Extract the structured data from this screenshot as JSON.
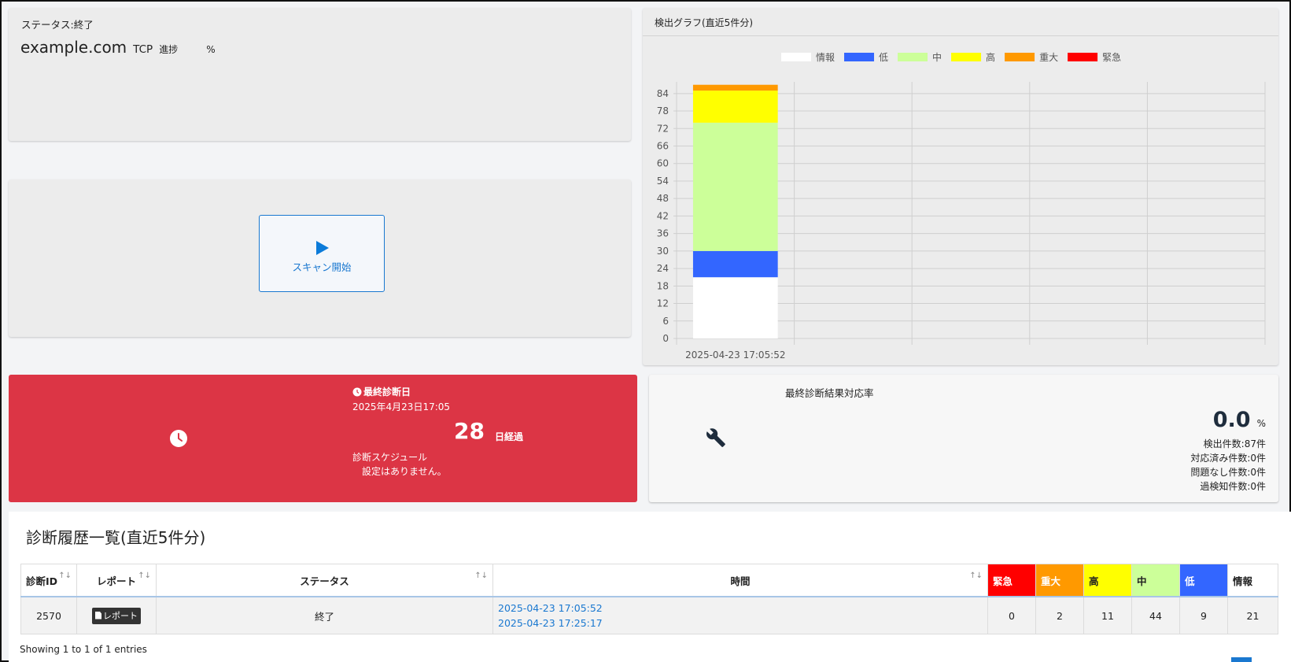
{
  "status": {
    "label": "ステータス:終了",
    "host": "example.com",
    "protocol": "TCP",
    "progress_label": "進捗",
    "progress_unit": "%"
  },
  "scan": {
    "button_label": "スキャン開始",
    "icon": "play-icon"
  },
  "chart_panel": {
    "title": "検出グラフ(直近5件分)"
  },
  "chart_data": {
    "type": "bar",
    "stacked": true,
    "categories": [
      "2025-04-23 17:05:52"
    ],
    "series": [
      {
        "name": "情報",
        "values": [
          21
        ],
        "color": "#ffffff"
      },
      {
        "name": "低",
        "values": [
          9
        ],
        "color": "#3366ff"
      },
      {
        "name": "中",
        "values": [
          44
        ],
        "color": "#ccff99"
      },
      {
        "name": "高",
        "values": [
          11
        ],
        "color": "#ffff00"
      },
      {
        "name": "重大",
        "values": [
          2
        ],
        "color": "#ff9900"
      },
      {
        "name": "緊急",
        "values": [
          0
        ],
        "color": "#ff0000"
      }
    ],
    "yticks": [
      0,
      6,
      12,
      18,
      24,
      30,
      36,
      42,
      48,
      54,
      60,
      66,
      72,
      78,
      84
    ],
    "ylim": [
      0,
      88
    ],
    "slots": 5,
    "grid": true,
    "legend": "top"
  },
  "last_scan": {
    "label": "最終診断日",
    "date": "2025年4月23日17:05",
    "days": "28",
    "days_unit": "日経過",
    "schedule_label": "診断スケジュール",
    "schedule_value": "設定はありません。"
  },
  "response": {
    "title": "最終診断結果対応率",
    "rate": "0.0",
    "rate_unit": "%",
    "detected": "検出件数:87件",
    "handled": "対応済み件数:0件",
    "no_issue": "問題なし件数:0件",
    "false_positive": "過検知件数:0件"
  },
  "history": {
    "title": "診断履歴一覧(直近5件分)",
    "headers": {
      "id": "診断ID",
      "report": "レポート",
      "status": "ステータス",
      "time": "時間",
      "critical": "緊急",
      "severe": "重大",
      "high": "高",
      "medium": "中",
      "low": "低",
      "info": "情報"
    },
    "header_colors": {
      "critical": "#ff0000",
      "severe": "#ff9900",
      "high": "#ffff00",
      "medium": "#ccff99",
      "low": "#3366ff"
    },
    "rows": [
      {
        "id": "2570",
        "report_label": "レポート",
        "status": "終了",
        "time_start": "2025-04-23 17:05:52",
        "time_end": "2025-04-23 17:25:17",
        "critical": "0",
        "severe": "2",
        "high": "11",
        "medium": "44",
        "low": "9",
        "info": "21"
      }
    ],
    "showing": "Showing 1 to 1 of 1 entries"
  }
}
